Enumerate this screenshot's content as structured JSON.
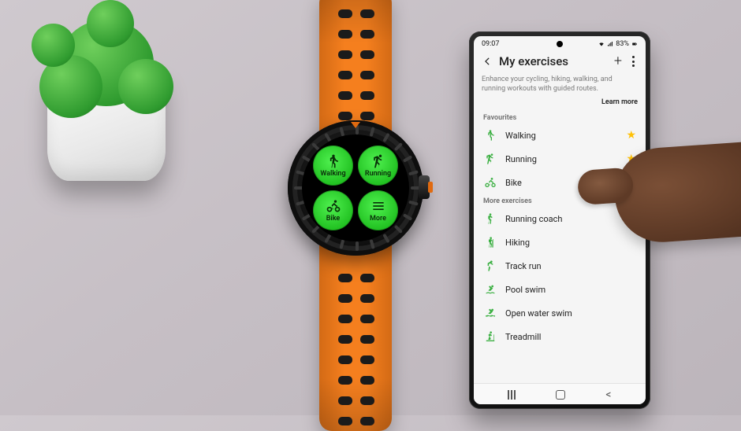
{
  "watch": {
    "apps": [
      {
        "label": "Walking",
        "icon": "walk"
      },
      {
        "label": "Running",
        "icon": "run"
      },
      {
        "label": "Bike",
        "icon": "bike"
      },
      {
        "label": "More",
        "icon": "more"
      }
    ]
  },
  "phone": {
    "status": {
      "time": "09:07",
      "battery": "83%"
    },
    "appbar": {
      "title": "My exercises"
    },
    "info": "Enhance your cycling, hiking, walking, and running workouts with guided routes.",
    "learn_more": "Learn more",
    "sections": {
      "favourites_title": "Favourites",
      "more_title": "More exercises"
    },
    "favourites": [
      {
        "label": "Walking",
        "icon": "walk",
        "starred": true
      },
      {
        "label": "Running",
        "icon": "run",
        "starred": true
      },
      {
        "label": "Bike",
        "icon": "bike",
        "starred": true
      }
    ],
    "more_exercises": [
      {
        "label": "Running coach",
        "icon": "coach"
      },
      {
        "label": "Hiking",
        "icon": "hike"
      },
      {
        "label": "Track run",
        "icon": "track"
      },
      {
        "label": "Pool swim",
        "icon": "swim"
      },
      {
        "label": "Open water swim",
        "icon": "open-swim"
      },
      {
        "label": "Treadmill",
        "icon": "treadmill"
      }
    ]
  }
}
